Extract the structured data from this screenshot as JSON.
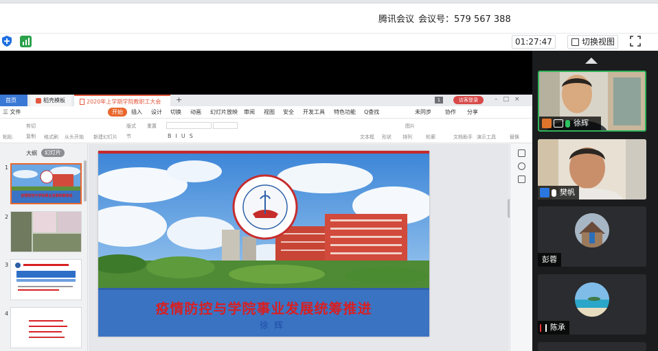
{
  "meeting": {
    "app_name": "腾讯会议",
    "id_label": "会议号：579 567 388",
    "timer": "01:27:47",
    "switch_view_label": "切换视图"
  },
  "participants": [
    {
      "name": "徐辉",
      "active": true
    },
    {
      "name": "樊帆",
      "active": false
    },
    {
      "name": "彭蓉",
      "active": false
    },
    {
      "name": "陈承",
      "active": false
    }
  ],
  "wps": {
    "tabs": [
      "首页",
      "稻壳模板",
      "2020年上学期学院教职工大会"
    ],
    "login_label": "访客登录",
    "menu": [
      "三 文件",
      "开始",
      "插入",
      "设计",
      "切换",
      "动画",
      "幻灯片放映",
      "审阅",
      "视图",
      "安全",
      "开发工具",
      "特色功能",
      "Q查找"
    ],
    "menu_right": [
      "未同步",
      "协作",
      "分享"
    ],
    "ribbon": [
      "粘贴",
      "剪切",
      "复制",
      "格式刷",
      "从头开始",
      "新建幻灯片",
      "版式",
      "节",
      "重置",
      "文本框",
      "形状",
      "排列",
      "图片",
      "轮廓",
      "文档助手",
      "演示工具",
      "替换"
    ],
    "pane_tabs": [
      "大纲",
      "幻灯片"
    ],
    "slide_numbers": [
      "1",
      "2",
      "3",
      "4"
    ],
    "slide": {
      "title": "疫情防控与学院事业发展统筹推进",
      "author": "徐辉"
    },
    "thumb1_title": "疫情防控与学院事业发展统筹推进"
  }
}
